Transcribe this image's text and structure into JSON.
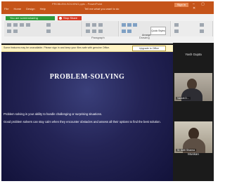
{
  "titlebar": {
    "doc_title": "PROBLEM-SOLVING.pptx - PowerPoint",
    "menu": [
      "File",
      "Home",
      "Design",
      "Help"
    ],
    "tell_me": "Tell me what you want to do",
    "sign_in": "Sign in",
    "window_controls": "– ▢ ✕"
  },
  "ribbon": {
    "green_button": "You are screensharing",
    "stop_share": "Stop Share",
    "section_paragraph": "Paragraph",
    "section_drawing": "Drawing",
    "arrange": "Arrange",
    "quick_styles": "Quick Styles"
  },
  "infobar": {
    "message": "Some features may be unavailable. Please sign in and keep your files safe with genuine Office.",
    "button": "Upgrade to Office"
  },
  "slide": {
    "title": "PROBLEM-SOLVING",
    "paragraph1": "Problem solving is your ability to handle challenging or surprising situations.",
    "paragraph2": "Good problem solvers can stay calm when they encounter obstacles and assess all their options to find the best solution."
  },
  "participants": {
    "name_top": "Yash Gupta",
    "tile1_tag": "Vanshi D...",
    "tile2_tag": "Sr. Aditi Sharma",
    "name_bottom": "Muskan"
  },
  "colors": {
    "titlebar": "#c5541a",
    "share_green": "#2e9a3b",
    "stop_red": "#d63a25",
    "slide_bg": "#242456"
  }
}
